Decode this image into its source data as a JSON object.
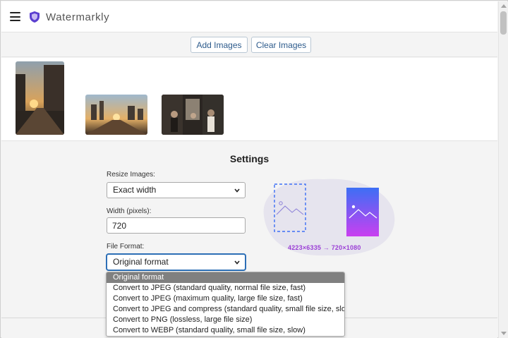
{
  "app": {
    "title": "Watermarkly"
  },
  "toolbar": {
    "add_label": "Add Images",
    "clear_label": "Clear Images"
  },
  "settings": {
    "title": "Settings",
    "resize_label": "Resize Images:",
    "resize_value": "Exact width",
    "width_label": "Width (pixels):",
    "width_value": "720",
    "format_label": "File Format:",
    "format_value": "Original format",
    "format_options": [
      "Original format",
      "Convert to JPEG (standard quality, normal file size, fast)",
      "Convert to JPEG (maximum quality, large file size, fast)",
      "Convert to JPEG and compress (standard quality, small file size, slow)",
      "Convert to PNG (lossless, large file size)",
      "Convert to WEBP (standard quality, small file size, slow)"
    ],
    "dimension_text": "4223×6335 → 720×1080"
  },
  "colors": {
    "accent": "#2d6fb6",
    "brand": "#5b3fd0",
    "gradient_top": "#3d6ff5",
    "gradient_bottom": "#c93ff0",
    "dim_text": "#9b3fd6"
  }
}
